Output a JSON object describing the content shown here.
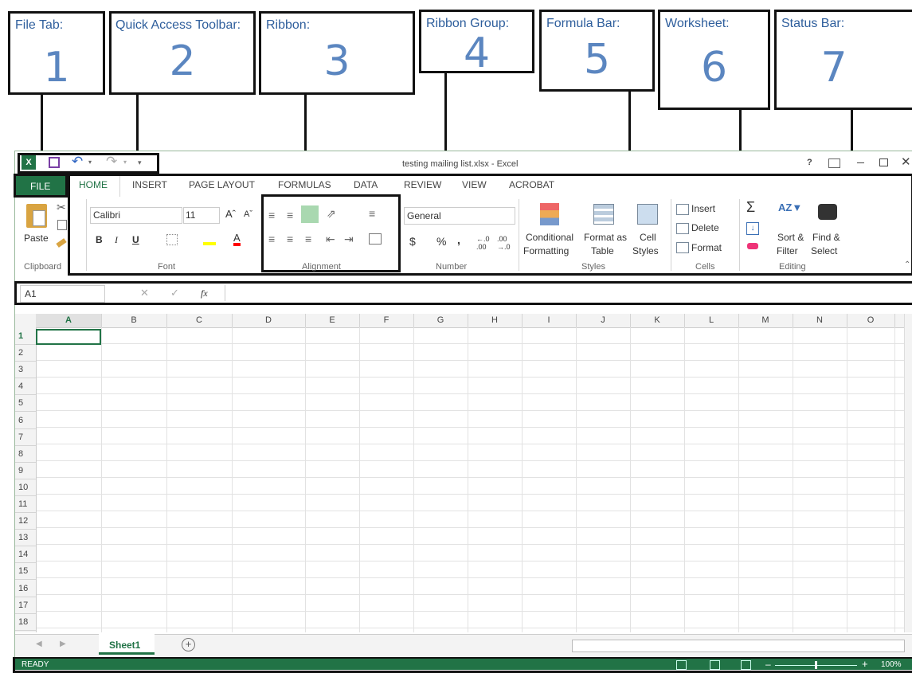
{
  "callouts": [
    {
      "title": "File Tab:",
      "num": "1"
    },
    {
      "title": "Quick Access Toolbar:",
      "num": "2"
    },
    {
      "title": "Ribbon:",
      "num": "3"
    },
    {
      "title": "Ribbon Group:",
      "num": "4"
    },
    {
      "title": "Formula Bar:",
      "num": "5"
    },
    {
      "title": "Worksheet:",
      "num": "6"
    },
    {
      "title": "Status Bar:",
      "num": "7"
    }
  ],
  "window": {
    "title": "testing mailing list.xlsx - Excel",
    "help": "?"
  },
  "tabs": {
    "file": "FILE",
    "home": "HOME",
    "insert": "INSERT",
    "page_layout": "PAGE LAYOUT",
    "formulas": "FORMULAS",
    "data": "DATA",
    "review": "REVIEW",
    "view": "VIEW",
    "acrobat": "ACROBAT"
  },
  "ribbon": {
    "paste": "Paste",
    "font_name": "Calibri",
    "font_size": "11",
    "bold": "B",
    "italic": "I",
    "underline": "U",
    "number_format": "General",
    "currency": "$",
    "percent": "%",
    "comma": ",",
    "dec_inc": "←.0 .00",
    "dec_dec": ".00 →.0",
    "conditional": "Conditional",
    "formatting": "Formatting",
    "format_as": "Format as",
    "table": "Table",
    "cell": "Cell",
    "styles_btn": "Styles",
    "insert": "Insert",
    "delete": "Delete",
    "format": "Format",
    "sort": "Sort &",
    "filter": "Filter",
    "find": "Find &",
    "select": "Select"
  },
  "groups": {
    "clipboard": "Clipboard",
    "font": "Font",
    "alignment": "Alignment",
    "number": "Number",
    "styles": "Styles",
    "cells": "Cells",
    "editing": "Editing"
  },
  "formula_bar": {
    "name_box": "A1",
    "fx": "fx",
    "value": ""
  },
  "grid": {
    "columns": [
      "A",
      "B",
      "C",
      "D",
      "E",
      "F",
      "G",
      "H",
      "I",
      "J",
      "K",
      "L",
      "M",
      "N",
      "O"
    ],
    "rows": [
      "1",
      "2",
      "3",
      "4",
      "5",
      "6",
      "7",
      "8",
      "9",
      "10",
      "11",
      "12",
      "13",
      "14",
      "15",
      "16",
      "17",
      "18"
    ]
  },
  "sheet_tabs": {
    "sheet1": "Sheet1",
    "add": "+"
  },
  "status": {
    "ready": "READY",
    "zoom": "100%"
  },
  "colors": {
    "excel_green": "#217346",
    "callout_text": "#2e5e9c",
    "callout_num": "#5b86c0"
  }
}
